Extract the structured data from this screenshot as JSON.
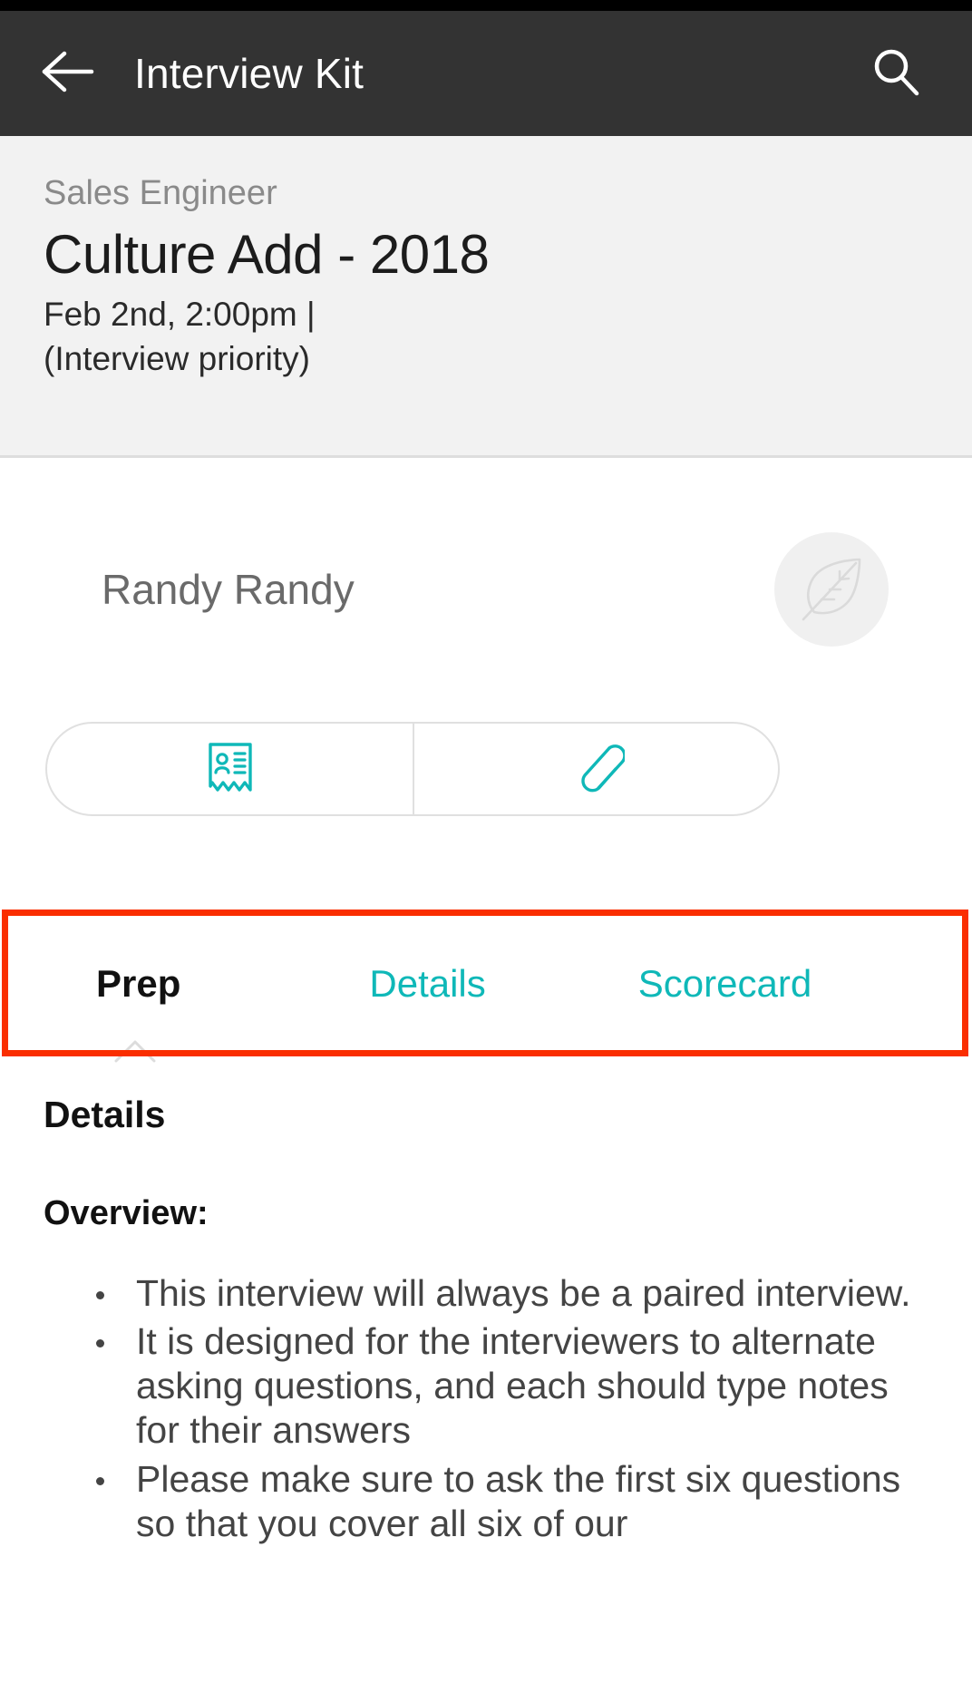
{
  "appbar": {
    "back_icon": "arrow-left-icon",
    "title": "Interview Kit",
    "search_icon": "search-icon"
  },
  "info": {
    "role": "Sales Engineer",
    "title": "Culture Add - 2018",
    "when": "Feb 2nd, 2:00pm |",
    "priority": "(Interview priority)"
  },
  "candidate": {
    "name": "Randy Randy",
    "avatar_icon": "leaf-icon"
  },
  "actions": [
    {
      "name": "resume-button",
      "icon": "resume-card-icon"
    },
    {
      "name": "attachments-button",
      "icon": "paperclip-icon"
    }
  ],
  "tabs": [
    {
      "label": "Prep",
      "active": true
    },
    {
      "label": "Details",
      "active": false
    },
    {
      "label": "Scorecard",
      "active": false
    }
  ],
  "content": {
    "heading": "Details",
    "subheading": "Overview:",
    "bullets": [
      "This interview will always be a paired interview.",
      "It is designed for the interviewers to alternate asking questions, and each should type notes for their answers",
      "Please make sure to ask the first six questions so that you cover all six of our"
    ]
  },
  "colors": {
    "appbar_bg": "#333333",
    "info_bg": "#f2f2f2",
    "accent_teal": "#0fb8b8",
    "highlight_red": "#fa2e00",
    "text_dark": "#111111",
    "text_muted": "#8a8a8a"
  }
}
